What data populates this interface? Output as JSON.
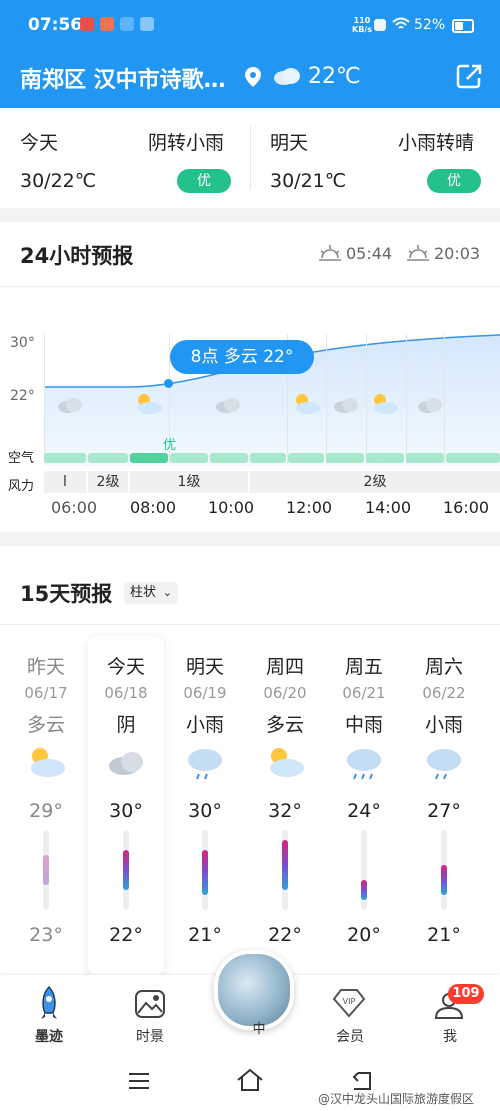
{
  "status": {
    "time": "07:56",
    "net_speed": "110\nKB/s",
    "battery": "52%"
  },
  "header": {
    "location": "南郑区 汉中市诗歌…",
    "temp": "22℃"
  },
  "today": {
    "label": "今天",
    "condition": "阴转小雨",
    "temp": "30/22℃",
    "aqi": "优"
  },
  "tomorrow": {
    "label": "明天",
    "condition": "小雨转晴",
    "temp": "30/21℃",
    "aqi": "优"
  },
  "hourly": {
    "title": "24小时预报",
    "sunrise": "05:44",
    "sunset": "20:03",
    "y_ticks": [
      "30°",
      "22°"
    ],
    "row_air": "空气",
    "row_wind": "风力",
    "tooltip": "8点 多云 22°",
    "aqi_label": "优",
    "wind_levels": [
      "l",
      "2级",
      "1级",
      "2级"
    ],
    "times": [
      "06:00",
      "08:00",
      "10:00",
      "12:00",
      "14:00",
      "16:00"
    ]
  },
  "daily": {
    "title": "15天预报",
    "mode": "柱状",
    "days": [
      {
        "name": "昨天",
        "date": "06/17",
        "cond": "多云",
        "hi": "29°",
        "lo": "23°",
        "icon": "partly-cloudy-icon"
      },
      {
        "name": "今天",
        "date": "06/18",
        "cond": "阴",
        "hi": "30°",
        "lo": "22°",
        "icon": "cloudy-icon"
      },
      {
        "name": "明天",
        "date": "06/19",
        "cond": "小雨",
        "hi": "30°",
        "lo": "21°",
        "icon": "light-rain-icon"
      },
      {
        "name": "周四",
        "date": "06/20",
        "cond": "多云",
        "hi": "32°",
        "lo": "22°",
        "icon": "partly-cloudy-icon"
      },
      {
        "name": "周五",
        "date": "06/21",
        "cond": "中雨",
        "hi": "24°",
        "lo": "20°",
        "icon": "moderate-rain-icon"
      },
      {
        "name": "周六",
        "date": "06/22",
        "cond": "小雨",
        "hi": "27°",
        "lo": "21°",
        "icon": "light-rain-icon"
      }
    ]
  },
  "nav": {
    "items": [
      "墨迹",
      "时景",
      "中",
      "会员",
      "我"
    ],
    "badge": "109"
  },
  "watermark": "@汉中龙头山国际旅游度假区",
  "colors": {
    "accent": "#2196f3",
    "aqi_good": "#23c28a"
  }
}
